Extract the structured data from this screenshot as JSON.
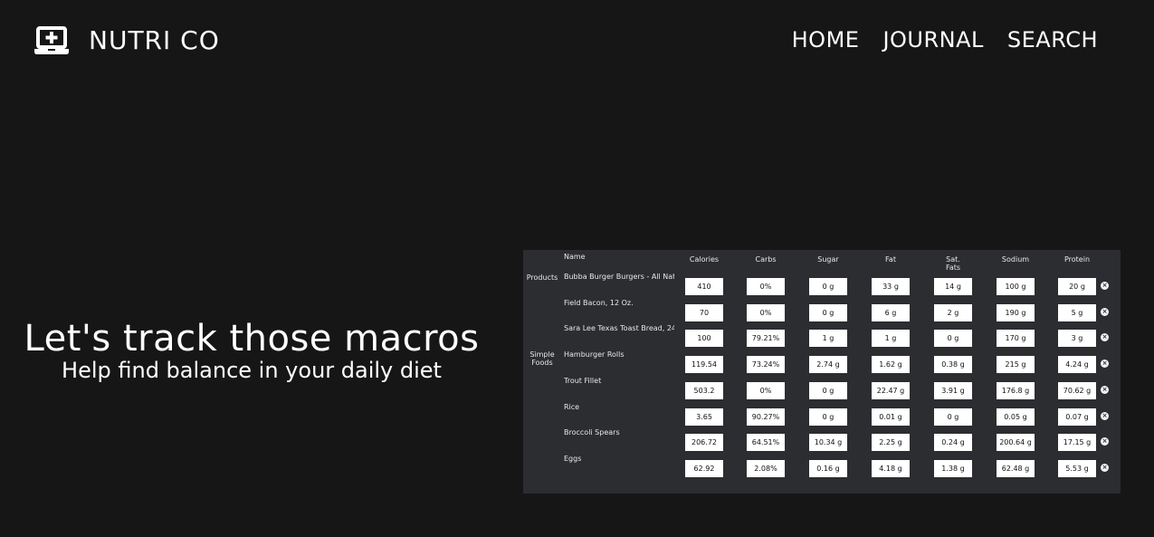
{
  "header": {
    "brand": "NUTRI CO",
    "nav": [
      "HOME",
      "JOURNAL",
      "SEARCH"
    ]
  },
  "hero": {
    "title": "Let's track those macros",
    "subtitle": "Help find balance in your daily diet"
  },
  "table": {
    "name_header": "Name",
    "columns": [
      "Calories",
      "Carbs",
      "Sugar",
      "Fat",
      "Sat.\nFats",
      "Sodium",
      "Protein"
    ],
    "groups": [
      {
        "label": "Products",
        "row": 0
      },
      {
        "label": "Simple\nFoods",
        "row": 3
      }
    ],
    "rows": [
      {
        "name": "Bubba Burger Burgers - All Nat",
        "values": [
          "410",
          "0%",
          "0 g",
          "33 g",
          "14 g",
          "100 g",
          "20 g"
        ]
      },
      {
        "name": "Field Bacon, 12 Oz.",
        "values": [
          "70",
          "0%",
          "0 g",
          "6 g",
          "2 g",
          "190 g",
          "5 g"
        ]
      },
      {
        "name": "Sara Lee Texas Toast Bread, 24",
        "values": [
          "100",
          "79.21%",
          "1 g",
          "1 g",
          "0 g",
          "170 g",
          "3 g"
        ]
      },
      {
        "name": "Hamburger Rolls",
        "values": [
          "119.54",
          "73.24%",
          "2.74 g",
          "1.62 g",
          "0.38 g",
          "215 g",
          "4.24 g"
        ]
      },
      {
        "name": "Trout Fillet",
        "values": [
          "503.2",
          "0%",
          "0 g",
          "22.47 g",
          "3.91 g",
          "176.8 g",
          "70.62 g"
        ]
      },
      {
        "name": "Rice",
        "values": [
          "3.65",
          "90.27%",
          "0 g",
          "0.01 g",
          "0 g",
          "0.05 g",
          "0.07 g"
        ]
      },
      {
        "name": "Broccoli Spears",
        "values": [
          "206.72",
          "64.51%",
          "10.34 g",
          "2.25 g",
          "0.24 g",
          "200.64 g",
          "17.15 g"
        ]
      },
      {
        "name": "Eggs",
        "values": [
          "62.92",
          "2.08%",
          "0.16 g",
          "4.18 g",
          "1.38 g",
          "62.48 g",
          "5.53 g"
        ]
      }
    ],
    "delete_icon": "close-circle-icon"
  },
  "colors": {
    "background": "#161617",
    "panel": "#2b2d31",
    "text": "#ffffff"
  }
}
